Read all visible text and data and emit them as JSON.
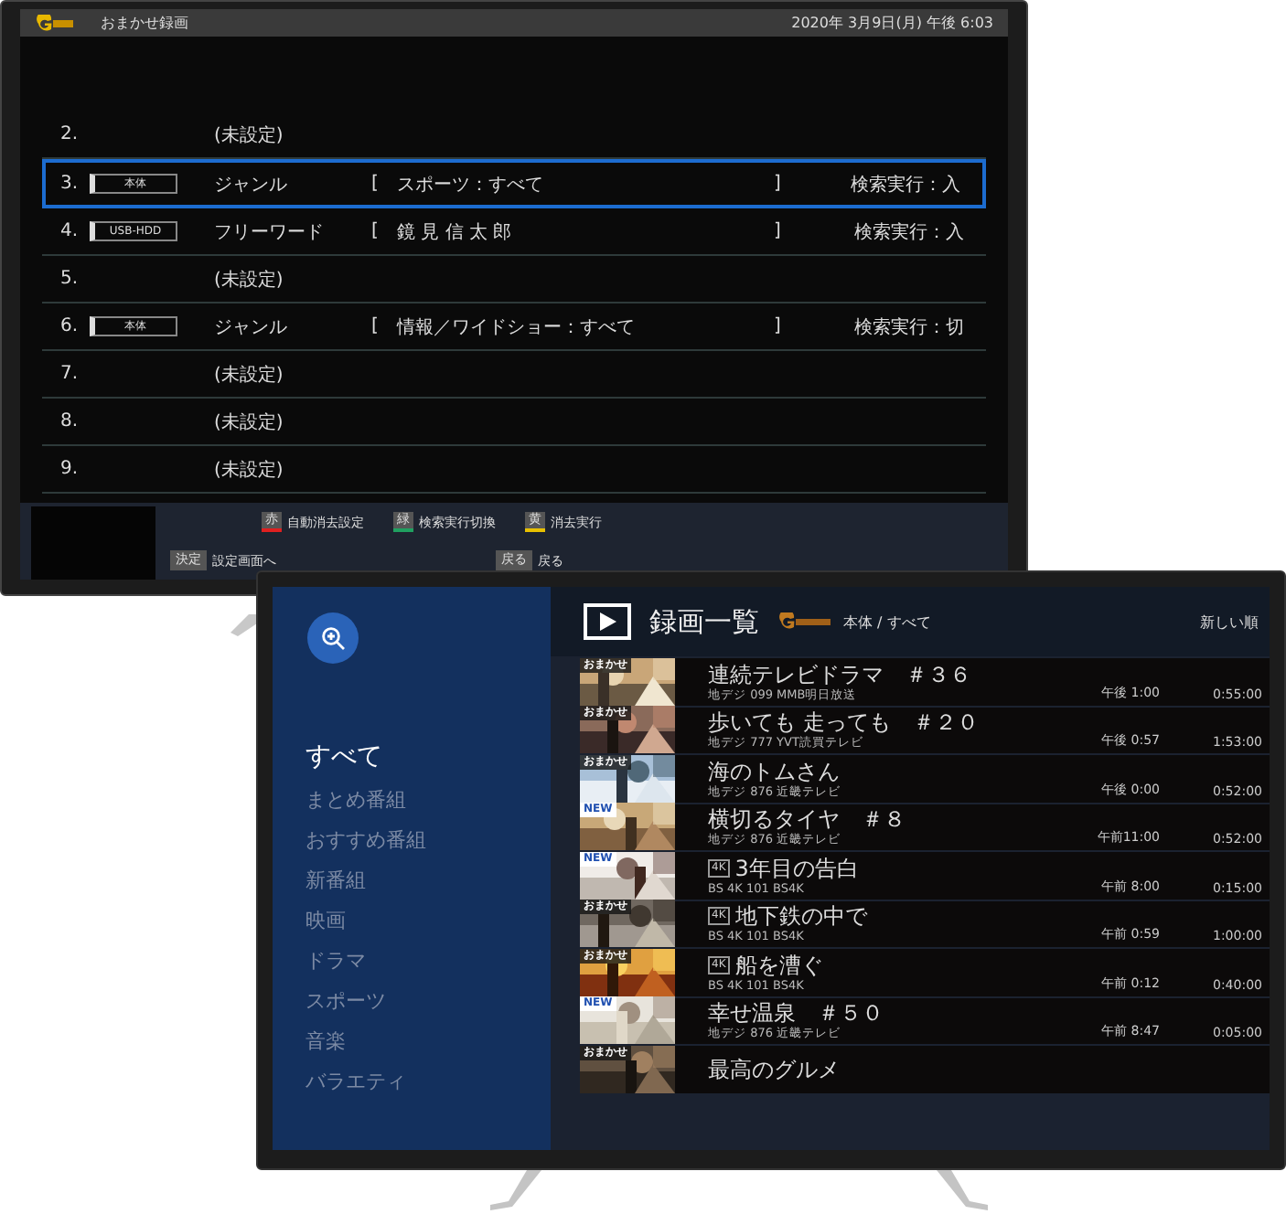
{
  "back_tv": {
    "title_bar": {
      "title": "おまかせ録画",
      "datetime": "2020年 3月9日(月) 午後 6:03"
    },
    "rows": [
      {
        "number": "2.",
        "type": "(未設定)",
        "selected": false
      },
      {
        "number": "3.",
        "device": "本体",
        "type": "ジャンル",
        "open": "[",
        "condition": "スポーツ：すべて",
        "close": "]",
        "search": "検索実行：入",
        "selected": true
      },
      {
        "number": "4.",
        "device": "USB-HDD",
        "type": "フリーワード",
        "open": "[",
        "condition": "鏡 見 信 太 郎",
        "close": "]",
        "search": "検索実行：入",
        "selected": false
      },
      {
        "number": "5.",
        "type": "(未設定)",
        "selected": false
      },
      {
        "number": "6.",
        "device": "本体",
        "type": "ジャンル",
        "open": "[",
        "condition": "情報／ワイドショー：すべて",
        "close": "]",
        "search": "検索実行：切",
        "selected": false
      },
      {
        "number": "7.",
        "type": "(未設定)",
        "selected": false
      },
      {
        "number": "8.",
        "type": "(未設定)",
        "selected": false
      },
      {
        "number": "9.",
        "type": "(未設定)",
        "selected": false
      }
    ],
    "color_keys": [
      {
        "key": "赤",
        "label": "自動消去設定",
        "color": "#e02020"
      },
      {
        "key": "緑",
        "label": "検索実行切換",
        "color": "#20a060"
      },
      {
        "key": "黄",
        "label": "消去実行",
        "color": "#e8c000"
      }
    ],
    "keys": [
      {
        "key": "決定",
        "label": "設定画面へ"
      },
      {
        "key": "戻る",
        "label": "戻る"
      }
    ]
  },
  "front_tv": {
    "sidebar": {
      "items": [
        {
          "label": "すべて",
          "selected": true
        },
        {
          "label": "まとめ番組",
          "selected": false
        },
        {
          "label": "おすすめ番組",
          "selected": false
        },
        {
          "label": "新番組",
          "selected": false
        },
        {
          "label": "映画",
          "selected": false
        },
        {
          "label": "ドラマ",
          "selected": false
        },
        {
          "label": "スポーツ",
          "selected": false
        },
        {
          "label": "音楽",
          "selected": false
        },
        {
          "label": "バラエティ",
          "selected": false
        }
      ]
    },
    "header": {
      "title": "録画一覧",
      "path": "本体 / すべて",
      "sort": "新しい順"
    },
    "recordings": [
      {
        "badge": {
          "text": "おまかせ",
          "kind": "omakase"
        },
        "title": "連続テレビドラマ　＃３６",
        "channel": "地デジ 099 MMB明日放送",
        "time": "午後 1:00",
        "duration": "0:55:00"
      },
      {
        "badge": {
          "text": "おまかせ",
          "kind": "omakase"
        },
        "title": "歩いても 走っても　＃２０",
        "channel": "地デジ 777 YVT読買テレビ",
        "time": "午後 0:57",
        "duration": "1:53:00"
      },
      {
        "badge": {
          "text": "おまかせ",
          "kind": "omakase"
        },
        "title": "海のトムさん",
        "channel": "地デジ 876 近畿テレビ",
        "time": "午後 0:00",
        "duration": "0:52:00"
      },
      {
        "badge": {
          "text": "NEW",
          "kind": "new"
        },
        "title": "横切るタイヤ　＃８",
        "channel": "地デジ 876 近畿テレビ",
        "time": "午前11:00",
        "duration": "0:52:00"
      },
      {
        "badge": {
          "text": "NEW",
          "kind": "new"
        },
        "tag": "4K",
        "title": "3年目の告白",
        "channel": "BS 4K 101 BS4K",
        "time": "午前 8:00",
        "duration": "0:15:00"
      },
      {
        "badge": {
          "text": "おまかせ",
          "kind": "omakase"
        },
        "tag": "4K",
        "title": "地下鉄の中で",
        "channel": "BS 4K 101 BS4K",
        "time": "午前 0:59",
        "duration": "1:00:00"
      },
      {
        "badge": {
          "text": "おまかせ",
          "kind": "omakase"
        },
        "tag": "4K",
        "title": "船を漕ぐ",
        "channel": "BS 4K 101 BS4K",
        "time": "午前 0:12",
        "duration": "0:40:00"
      },
      {
        "badge": {
          "text": "NEW",
          "kind": "new"
        },
        "title": "幸せ温泉　＃５０",
        "channel": "地デジ 876 近畿テレビ",
        "time": "午前 8:47",
        "duration": "0:05:00"
      },
      {
        "badge": {
          "text": "おまかせ",
          "kind": "omakase"
        },
        "title": "最高のグルメ"
      }
    ]
  }
}
